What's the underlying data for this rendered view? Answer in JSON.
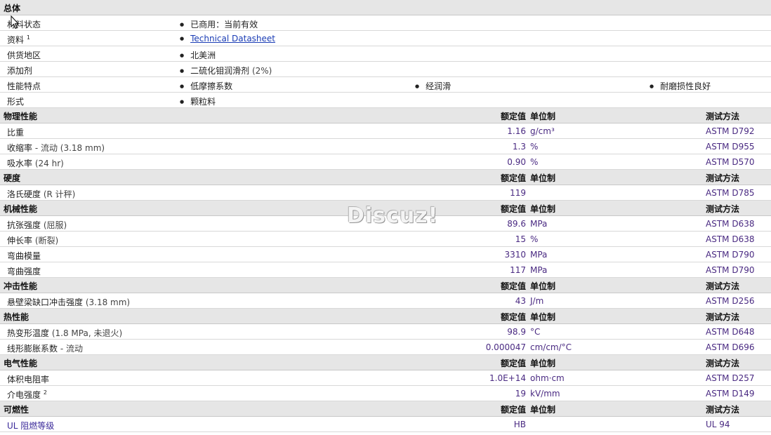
{
  "general": {
    "title": "总体",
    "rows": [
      {
        "label": "材料状态",
        "items": [
          "已商用：当前有效"
        ]
      },
      {
        "label": "资料",
        "sup": "1",
        "link": "Technical Datasheet"
      },
      {
        "label": "供货地区",
        "items": [
          "北美洲"
        ]
      },
      {
        "label": "添加剂",
        "items": [
          "二硫化钼润滑剂",
          "(2%)"
        ]
      },
      {
        "label": "性能特点",
        "items": [
          "低摩擦系数",
          "经润滑",
          "耐磨损性良好"
        ]
      },
      {
        "label": "形式",
        "items": [
          "颗粒料"
        ]
      }
    ]
  },
  "headers": {
    "value": "额定值",
    "unit": "单位制",
    "test": "测试方法"
  },
  "sections": [
    {
      "title": "物理性能",
      "rows": [
        {
          "label": "比重",
          "cond": "",
          "value": "1.16",
          "unit": "g/cm³",
          "test": "ASTM D792"
        },
        {
          "label": "收缩率",
          "cond": " - 流动  (3.18 mm)",
          "value": "1.3",
          "unit": "%",
          "test": "ASTM D955"
        },
        {
          "label": "吸水率",
          "cond": "  (24 hr)",
          "value": "0.90",
          "unit": "%",
          "test": "ASTM D570"
        }
      ]
    },
    {
      "title": "硬度",
      "rows": [
        {
          "label": "洛氏硬度",
          "cond": "  (R 计秤)",
          "value": "119",
          "unit": "",
          "test": "ASTM D785"
        }
      ]
    },
    {
      "title": "机械性能",
      "rows": [
        {
          "label": "抗张强度",
          "cond": "  (屈服)",
          "value": "89.6",
          "unit": "MPa",
          "test": "ASTM D638"
        },
        {
          "label": "伸长率",
          "cond": "  (断裂)",
          "value": "15",
          "unit": "%",
          "test": "ASTM D638"
        },
        {
          "label": "弯曲模量",
          "cond": "",
          "value": "3310",
          "unit": "MPa",
          "test": "ASTM D790"
        },
        {
          "label": "弯曲强度",
          "cond": "",
          "value": "117",
          "unit": "MPa",
          "test": "ASTM D790"
        }
      ]
    },
    {
      "title": "冲击性能",
      "rows": [
        {
          "label": "悬壁梁缺口冲击强度",
          "cond": "  (3.18 mm)",
          "value": "43",
          "unit": "J/m",
          "test": "ASTM D256"
        }
      ]
    },
    {
      "title": "热性能",
      "rows": [
        {
          "label": "热变形温度",
          "cond": "  (1.8 MPa, 未退火)",
          "value": "98.9",
          "unit": "°C",
          "test": "ASTM D648"
        },
        {
          "label": "线形膨胀系数",
          "cond": " - 流动",
          "value": "0.000047",
          "unit": "cm/cm/°C",
          "test": "ASTM D696"
        }
      ]
    },
    {
      "title": "电气性能",
      "rows": [
        {
          "label": "体积电阻率",
          "cond": "",
          "value": "1.0E+14",
          "unit": "ohm·cm",
          "test": "ASTM D257"
        },
        {
          "label": "介电强度",
          "sup": "2",
          "cond": "",
          "value": "19",
          "unit": "kV/mm",
          "test": "ASTM D149"
        }
      ]
    },
    {
      "title": "可燃性",
      "rows": [
        {
          "label": "UL 阻燃等级",
          "cond": "",
          "value": "HB",
          "unit": "",
          "test": "UL 94",
          "blue": true
        }
      ]
    }
  ],
  "watermark": "Discuz!"
}
